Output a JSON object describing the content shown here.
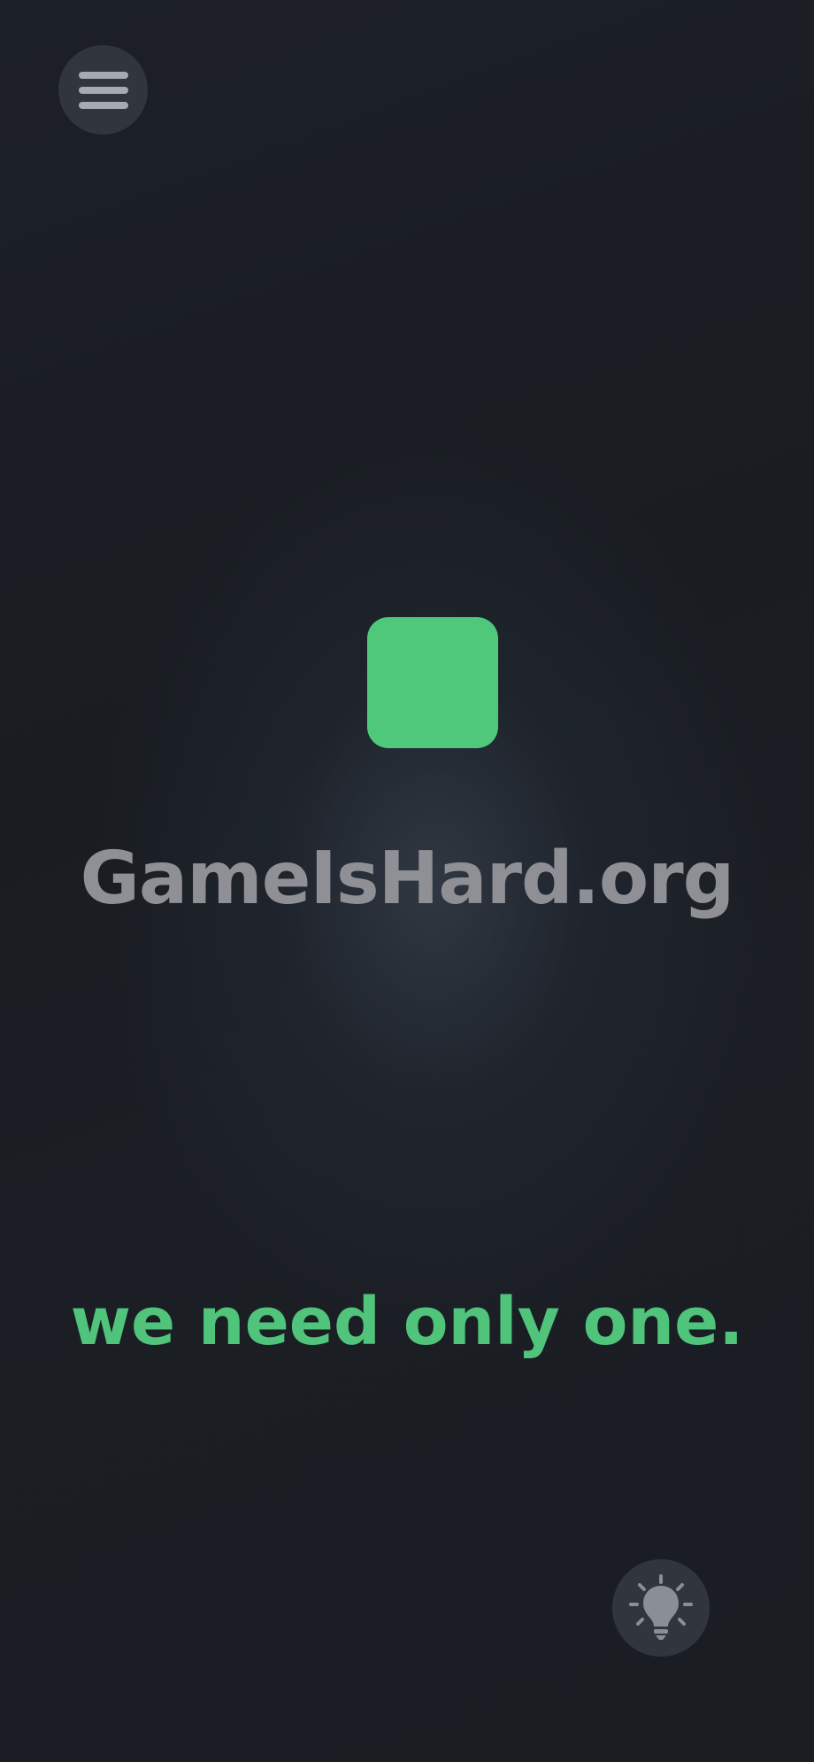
{
  "game": {
    "title": "GameIsHard.org",
    "tagline": "we need only one."
  },
  "controls": {
    "menu_icon": "hamburger-menu-icon",
    "hint_icon": "lightbulb-icon"
  },
  "colors": {
    "background": "#1a1e24",
    "accent_green": "#50c87b",
    "title_gray": "#8e9095",
    "button_bg": "#30353e",
    "icon_gray": "#a7aab1"
  }
}
